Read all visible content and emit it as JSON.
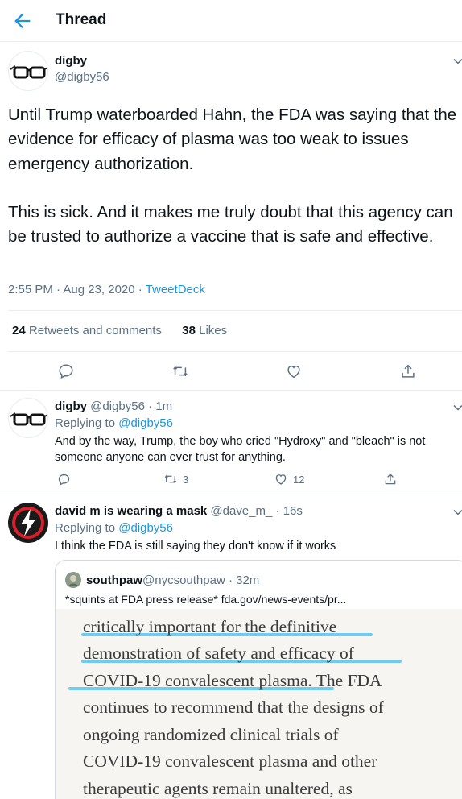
{
  "header": {
    "title": "Thread"
  },
  "main_tweet": {
    "name": "digby",
    "handle": "@digby56",
    "text": "Until Trump waterboarded Hahn, the FDA was saying that the evidence for efficacy of plasma was too weak to issues emergency authorization.\n\nThis is sick. And it makes me truly doubt that this agency can be trusted to authorize a vaccine that is safe and effective.",
    "time": "2:55 PM · Aug 23, 2020 · ",
    "source": "TweetDeck",
    "retweets_count": "24",
    "retweets_label": " Retweets and comments",
    "likes_count": "38",
    "likes_label": " Likes"
  },
  "reply1": {
    "name": "digby",
    "handle": " @digby56 · 1m",
    "replying_prefix": "Replying to ",
    "replying_to": "@digby56",
    "text": "And by the way, Trump, the boy who cried \"Hydroxy\" and \"bleach\"  is not someone anyone can ever trust for anything.",
    "retweets": "3",
    "likes": "12"
  },
  "reply2": {
    "name": "david m is wearing a mask",
    "handle": " @dave_m_ · 16s",
    "replying_prefix": "Replying to ",
    "replying_to": "@digby56",
    "text": "I think the FDA is still saying they don't know if it works",
    "quote": {
      "name": "southpaw",
      "handle": " @nycsouthpaw · 32m",
      "text": "*squints at FDA press release* fda.gov/news-events/pr...",
      "image_lines": [
        "critically important for the definitive",
        "demonstration of safety and efficacy of",
        "COVID-19 convalescent plasma. The FDA",
        "continues to recommend that the designs of",
        "ongoing randomized clinical trials of",
        "COVID-19 convalescent plasma and other",
        "therapeutic agents remain unaltered, as"
      ]
    }
  },
  "colors": {
    "accent": "#1b95e0",
    "text": "#0f1419",
    "secondary": "#5b7083",
    "highlight": "#5ec8ee"
  },
  "icons": [
    "back-arrow-icon",
    "chevron-down-icon",
    "reply-icon",
    "retweet-icon",
    "like-icon",
    "share-icon",
    "glasses-avatar",
    "lightning-avatar"
  ]
}
